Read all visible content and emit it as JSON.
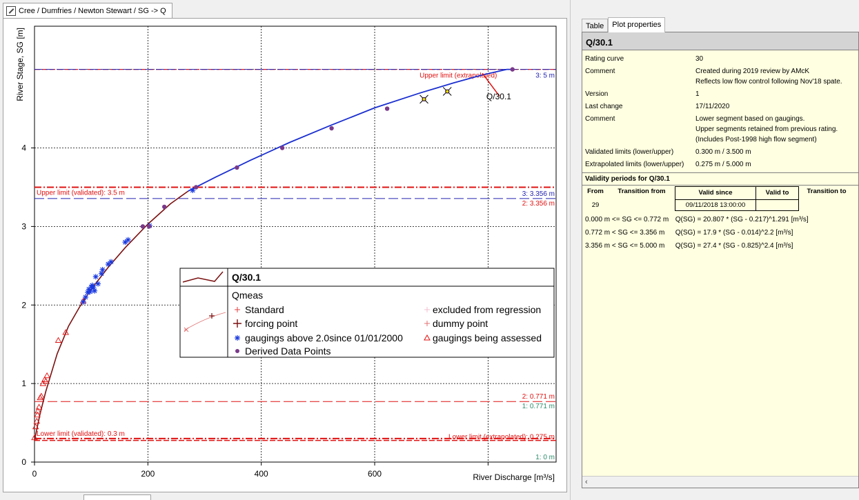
{
  "window": {
    "title": "Cree / Dumfries / Newton Stewart / SG -> Q"
  },
  "tabs": [
    {
      "label": "Table",
      "active": false
    },
    {
      "label": "Plot properties",
      "active": true
    }
  ],
  "properties": {
    "header": "Q/30.1",
    "rating_curve_label": "Rating curve",
    "rating_curve_value": "30",
    "comment1_label": "Comment",
    "comment1_lines": [
      "Created during 2019 review by AMcK",
      "Reflects low flow control following Nov'18 spate."
    ],
    "version_label": "Version",
    "version_value": "1",
    "last_change_label": "Last change",
    "last_change_value": "17/11/2020",
    "comment2_label": "Comment",
    "comment2_lines": [
      "Lower segment based on gaugings.",
      "Upper segments retained from previous rating.",
      "(Includes Post-1998 high flow segment)"
    ],
    "validated_label": "Validated limits (lower/upper)",
    "validated_value": "0.300 m / 3.500 m",
    "extrapolated_label": "Extrapolated limits (lower/upper)",
    "extrapolated_value": "0.275 m / 5.000 m",
    "validity_title": "Validity periods for Q/30.1",
    "validity_headers": [
      "From",
      "Transition from",
      "Valid since",
      "Valid to",
      "Transition to"
    ],
    "validity_row": {
      "from": "29",
      "transition_from": "",
      "valid_since": "09/11/2018 13:00:00",
      "valid_to": "",
      "transition_to": ""
    },
    "equations": [
      {
        "range": "0.000 m <= SG <= 0.772 m",
        "formula": "Q(SG) = 20.807 * (SG - 0.217)^1.291  [m³/s]"
      },
      {
        "range": "0.772 m < SG <=  3.356 m",
        "formula": "Q(SG) = 17.9 * (SG - 0.014)^2.2  [m³/s]"
      },
      {
        "range": "3.356 m < SG <=  5.000 m",
        "formula": "Q(SG) = 27.4 * (SG - 0.825)^2.4  [m³/s]"
      }
    ]
  },
  "colors": {
    "curve_blue": "#1a2fd0",
    "curve_dark": "#7a1010",
    "limit_red": "#e01010",
    "segment_blue": "#2020b0",
    "derived_purple": "#7a3a8a",
    "gauging_blue": "#1a3ae0",
    "teal": "#2a8a6a"
  },
  "chart_data": {
    "type": "scatter",
    "xlabel": "River Discharge [m³/s]",
    "ylabel": "River Stage, SG [m]",
    "xlim": [
      0,
      920
    ],
    "ylim": [
      0,
      5.55
    ],
    "xticks": [
      0,
      200,
      400,
      600
    ],
    "yticks": [
      0,
      1,
      2,
      3,
      4
    ],
    "grid": true,
    "curve": {
      "name": "Q/30.1",
      "x": [
        0,
        5,
        10,
        20,
        40,
        60,
        80,
        100,
        130,
        160,
        200,
        240,
        271,
        320,
        380,
        450,
        520,
        600,
        680,
        740,
        790,
        833,
        845
      ],
      "y": [
        0.275,
        0.45,
        0.62,
        0.9,
        1.38,
        1.73,
        1.98,
        2.2,
        2.48,
        2.73,
        3.03,
        3.29,
        3.45,
        3.63,
        3.84,
        4.07,
        4.28,
        4.51,
        4.7,
        4.83,
        4.93,
        5.0,
        5.0
      ]
    },
    "limits": [
      {
        "label": "Upper limit (extrapolated)",
        "value": 5.0,
        "right_label": "3: 5 m"
      },
      {
        "label": "Upper limit (validated): 3.5 m",
        "value": 3.5
      },
      {
        "label": "3: 3.356 m",
        "value": 3.356
      },
      {
        "label": "2: 3.356 m",
        "value": 3.356
      },
      {
        "label": "2: 0.771 m",
        "value": 0.771
      },
      {
        "label": "1: 0.771 m",
        "value": 0.771
      },
      {
        "label": "Lower limit (validated): 0.3 m",
        "value": 0.3
      },
      {
        "label": "Lower limit (extrapolated): 0.275 m",
        "value": 0.275
      },
      {
        "label": "1: 0 m",
        "value": 0
      }
    ],
    "curve_label": "Q/30.1",
    "derived_points": {
      "name": "Derived Data Points",
      "x": [
        191,
        202,
        229,
        285,
        357,
        437,
        524,
        622,
        687,
        728,
        843
      ],
      "y": [
        3.0,
        3.0,
        3.25,
        3.5,
        3.75,
        4.0,
        4.25,
        4.5,
        4.62,
        4.72,
        5.0
      ]
    },
    "gaugings_above": {
      "name": "gaugings above 2.0since 01/01/2000",
      "x": [
        86,
        90,
        94,
        96,
        98,
        100,
        102,
        104,
        106,
        108,
        112,
        118,
        120,
        130,
        135,
        160,
        165,
        203,
        279
      ],
      "y": [
        2.04,
        2.1,
        2.16,
        2.2,
        2.17,
        2.23,
        2.25,
        2.22,
        2.18,
        2.36,
        2.27,
        2.4,
        2.45,
        2.52,
        2.55,
        2.8,
        2.83,
        3.01,
        3.46
      ]
    },
    "gaugings_assessed": {
      "name": "gaugings being assessed",
      "x": [
        0,
        2,
        4,
        5,
        6,
        8,
        10,
        12,
        15,
        18,
        20,
        22,
        42,
        55,
        86
      ],
      "y": [
        0.31,
        0.45,
        0.52,
        0.6,
        0.65,
        0.7,
        0.82,
        0.84,
        1.0,
        1.05,
        1.03,
        1.1,
        1.55,
        1.65,
        2.05
      ]
    },
    "marked_points": {
      "x": [
        687,
        728
      ],
      "y": [
        4.62,
        4.72
      ]
    },
    "legend": {
      "title": "Q/30.1",
      "group": "Qmeas",
      "entries": [
        "Standard",
        "forcing point",
        "gaugings above 2.0since 01/01/2000",
        "Derived Data Points",
        "excluded from regression",
        "dummy point",
        "gaugings being assessed"
      ]
    }
  }
}
